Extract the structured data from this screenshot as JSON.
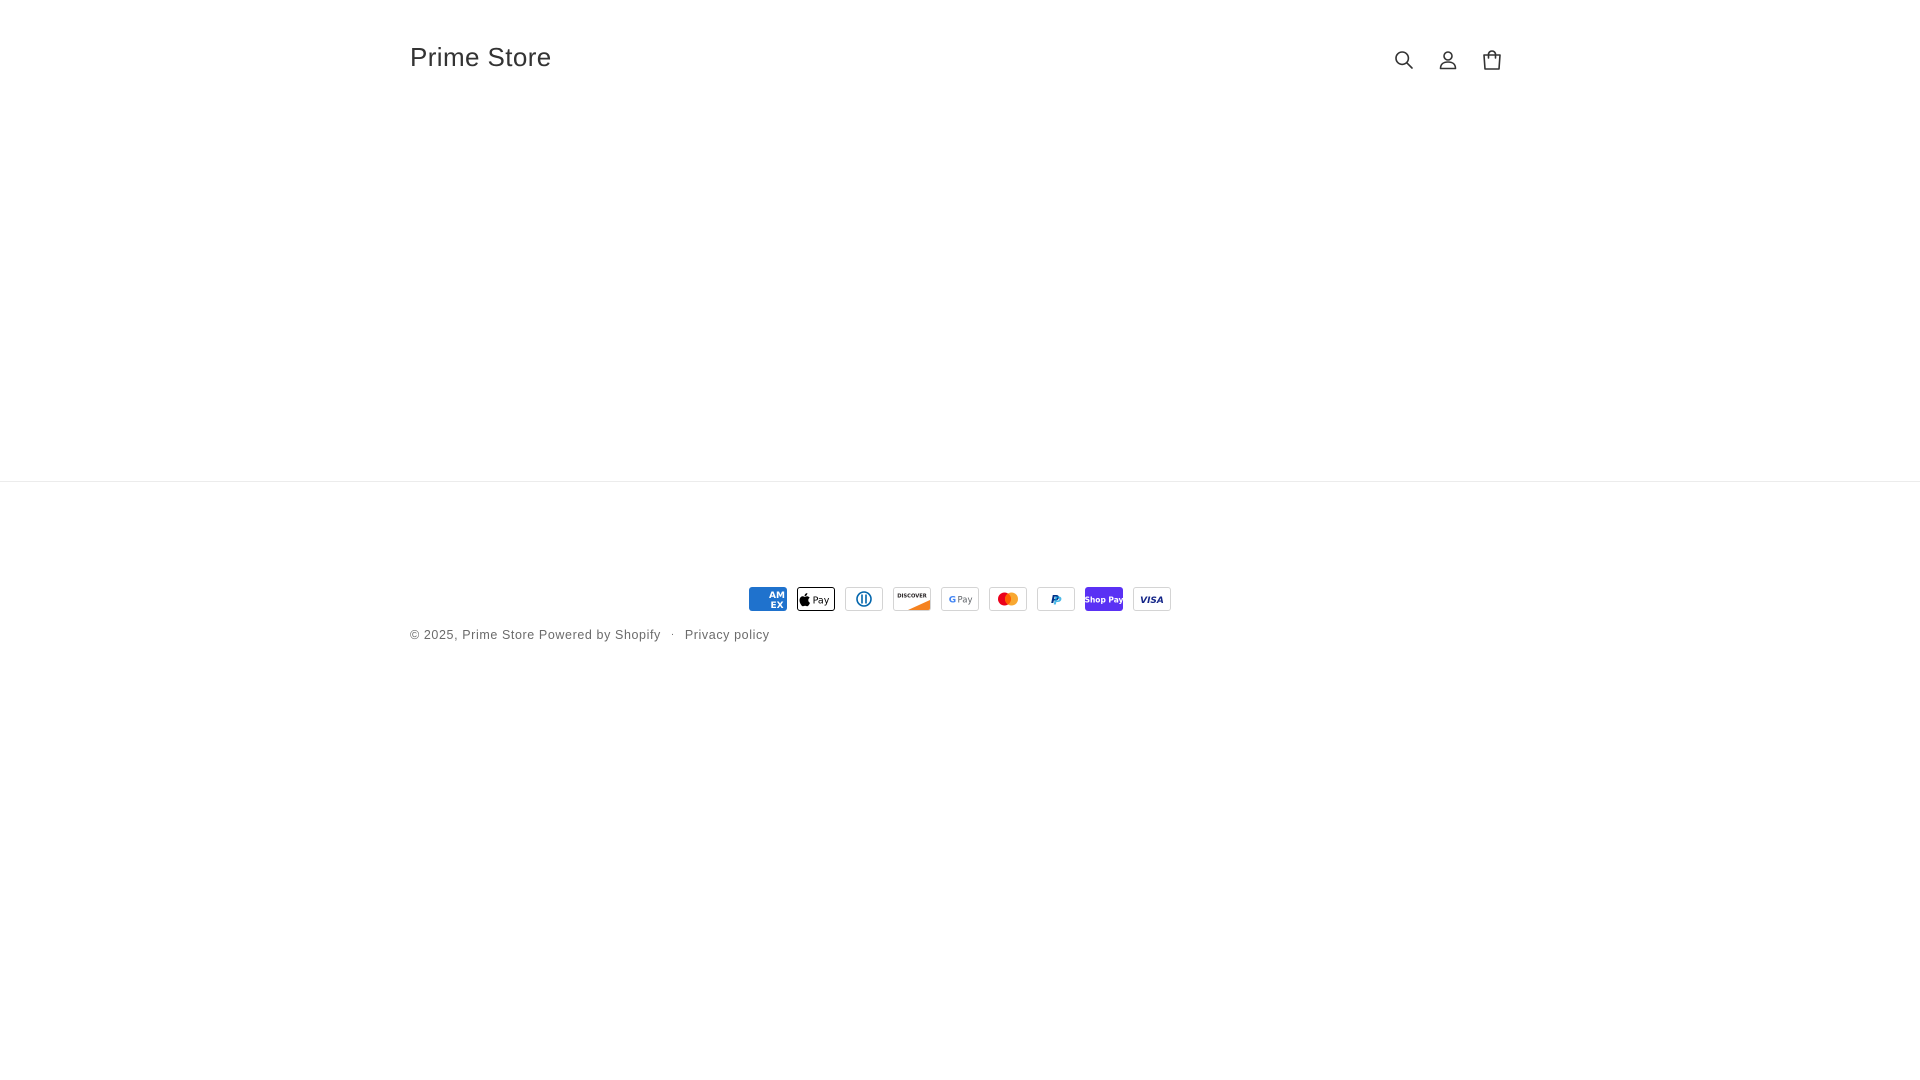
{
  "header": {
    "store_name": "Prime Store",
    "icons": [
      "search-icon",
      "account-icon",
      "cart-icon"
    ]
  },
  "footer": {
    "payment_methods": [
      {
        "name": "American Express",
        "label_top": "AM",
        "label_bottom": "EX",
        "color": "#1f72cd"
      },
      {
        "name": "Apple Pay",
        "label": "Pay",
        "glyph": "apple-icon",
        "color": "#000000"
      },
      {
        "name": "Diners Club",
        "label": "D",
        "color": "#0165ac"
      },
      {
        "name": "Discover",
        "label": "DISCOVER",
        "color": "#f58220"
      },
      {
        "name": "Google Pay",
        "label": "Pay",
        "color": "#5f6368"
      },
      {
        "name": "Mastercard",
        "color_left": "#eb001b",
        "color_right": "#f79e1b"
      },
      {
        "name": "PayPal",
        "label": "P",
        "color": "#003087"
      },
      {
        "name": "Shop Pay",
        "label": "Shop Pay",
        "color": "#5a31f4"
      },
      {
        "name": "Visa",
        "label": "VISA",
        "color": "#142688"
      }
    ],
    "copyright": "© 2025,",
    "store_link": "Prime Store",
    "powered_by": "Powered by Shopify",
    "separator": "·",
    "privacy_policy": "Privacy policy"
  },
  "colors": {
    "text": "#121212",
    "muted": "#6b6b6b",
    "divider": "#ececec",
    "background": "#ffffff"
  }
}
